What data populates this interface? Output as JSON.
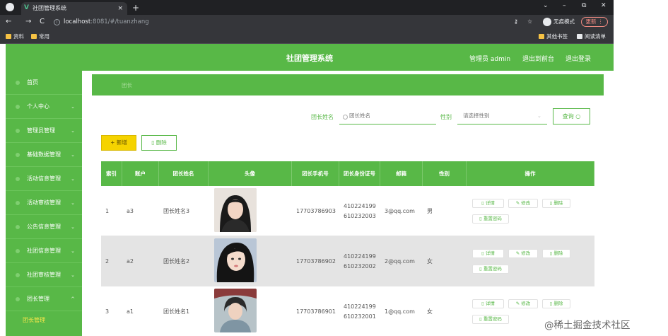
{
  "browser": {
    "tab_title": "社团管理系统",
    "tab_close": "×",
    "new_tab": "+",
    "url_host": "localhost",
    "url_path": ":8081/#/tuanzhang",
    "incognito_label": "无痕模式",
    "update_label": "更新",
    "bookmarks": [
      "资料",
      "常用"
    ],
    "bookmarks_right": [
      "其他书签",
      "阅读清单"
    ],
    "window_controls": [
      "⌄",
      "–",
      "⧉",
      "✕"
    ]
  },
  "header": {
    "title": "社团管理系统",
    "admin_label": "管理员 admin",
    "back_link": "退出到前台",
    "logout_link": "退出登录"
  },
  "sidebar": {
    "items": [
      {
        "label": "首页",
        "has_chevron": false
      },
      {
        "label": "个人中心",
        "has_chevron": true
      },
      {
        "label": "管理员管理",
        "has_chevron": true
      },
      {
        "label": "基础数据管理",
        "has_chevron": true
      },
      {
        "label": "活动信息管理",
        "has_chevron": true
      },
      {
        "label": "活动审核管理",
        "has_chevron": true
      },
      {
        "label": "公告信息管理",
        "has_chevron": true
      },
      {
        "label": "社团信息管理",
        "has_chevron": true
      },
      {
        "label": "社团审核管理",
        "has_chevron": true
      },
      {
        "label": "团长管理",
        "has_chevron": true
      }
    ],
    "active_sub": "团长管理",
    "chev_down": "⌄",
    "chev_up": "^"
  },
  "breadcrumb": {
    "current": "团长"
  },
  "search": {
    "name_label": "团长姓名",
    "name_placeholder": "团长姓名",
    "gender_label": "性别",
    "gender_placeholder": "请选择性别",
    "query_button": "查询"
  },
  "toolbar": {
    "add_button": "+ 新增",
    "delete_button": "删除"
  },
  "table": {
    "columns": [
      "索引",
      "账户",
      "团长姓名",
      "头像",
      "团长手机号",
      "团长身份证号",
      "邮箱",
      "性别",
      "操作"
    ],
    "rows": [
      {
        "index": "1",
        "account": "a3",
        "name": "团长姓名3",
        "phone": "17703786903",
        "id_card": "410224199610232003",
        "email": "3@qq.com",
        "gender": "男"
      },
      {
        "index": "2",
        "account": "a2",
        "name": "团长姓名2",
        "phone": "17703786902",
        "id_card": "410224199610232002",
        "email": "2@qq.com",
        "gender": "女"
      },
      {
        "index": "3",
        "account": "a1",
        "name": "团长姓名1",
        "phone": "17703786901",
        "id_card": "410224199610232001",
        "email": "1@qq.com",
        "gender": "女"
      }
    ],
    "actions": [
      "详情",
      "修改",
      "删除",
      "重置密码"
    ]
  },
  "watermark": "@稀土掘金技术社区",
  "colors": {
    "accent": "#58b847",
    "yellow": "#f5d300",
    "chrome_dark": "#202124"
  }
}
